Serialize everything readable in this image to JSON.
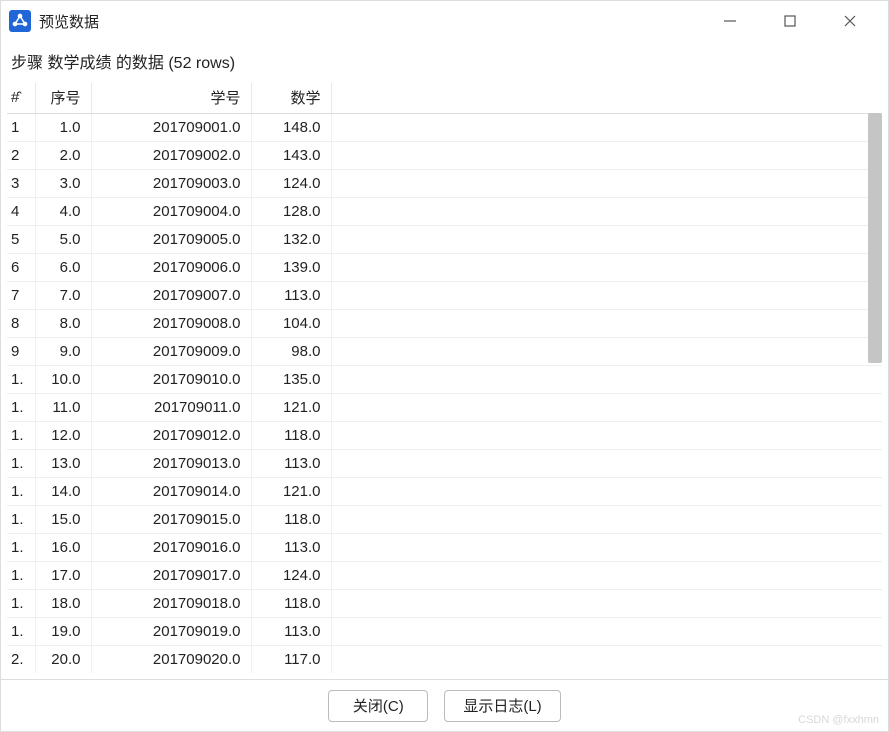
{
  "window": {
    "title": "预览数据",
    "subtitle": "步骤 数学成绩 的数据  (52 rows)"
  },
  "table": {
    "headers": {
      "idx": "#̂",
      "seq": "序号",
      "sid": "学号",
      "math": "数学"
    },
    "rows": [
      {
        "idx": "1",
        "seq": "1.0",
        "sid": "201709001.0",
        "math": "148.0"
      },
      {
        "idx": "2",
        "seq": "2.0",
        "sid": "201709002.0",
        "math": "143.0"
      },
      {
        "idx": "3",
        "seq": "3.0",
        "sid": "201709003.0",
        "math": "124.0"
      },
      {
        "idx": "4",
        "seq": "4.0",
        "sid": "201709004.0",
        "math": "128.0"
      },
      {
        "idx": "5",
        "seq": "5.0",
        "sid": "201709005.0",
        "math": "132.0"
      },
      {
        "idx": "6",
        "seq": "6.0",
        "sid": "201709006.0",
        "math": "139.0"
      },
      {
        "idx": "7",
        "seq": "7.0",
        "sid": "201709007.0",
        "math": "113.0"
      },
      {
        "idx": "8",
        "seq": "8.0",
        "sid": "201709008.0",
        "math": "104.0"
      },
      {
        "idx": "9",
        "seq": "9.0",
        "sid": "201709009.0",
        "math": "98.0"
      },
      {
        "idx": "1.",
        "seq": "10.0",
        "sid": "201709010.0",
        "math": "135.0"
      },
      {
        "idx": "1.",
        "seq": "11.0",
        "sid": "201709011.0",
        "math": "121.0"
      },
      {
        "idx": "1.",
        "seq": "12.0",
        "sid": "201709012.0",
        "math": "118.0"
      },
      {
        "idx": "1.",
        "seq": "13.0",
        "sid": "201709013.0",
        "math": "113.0"
      },
      {
        "idx": "1.",
        "seq": "14.0",
        "sid": "201709014.0",
        "math": "121.0"
      },
      {
        "idx": "1.",
        "seq": "15.0",
        "sid": "201709015.0",
        "math": "118.0"
      },
      {
        "idx": "1.",
        "seq": "16.0",
        "sid": "201709016.0",
        "math": "113.0"
      },
      {
        "idx": "1.",
        "seq": "17.0",
        "sid": "201709017.0",
        "math": "124.0"
      },
      {
        "idx": "1.",
        "seq": "18.0",
        "sid": "201709018.0",
        "math": "118.0"
      },
      {
        "idx": "1.",
        "seq": "19.0",
        "sid": "201709019.0",
        "math": "113.0"
      },
      {
        "idx": "2.",
        "seq": "20.0",
        "sid": "201709020.0",
        "math": "117.0"
      }
    ]
  },
  "buttons": {
    "close": "关闭(C)",
    "show_log": "显示日志(L)"
  },
  "watermark": "CSDN @fxxhmn"
}
